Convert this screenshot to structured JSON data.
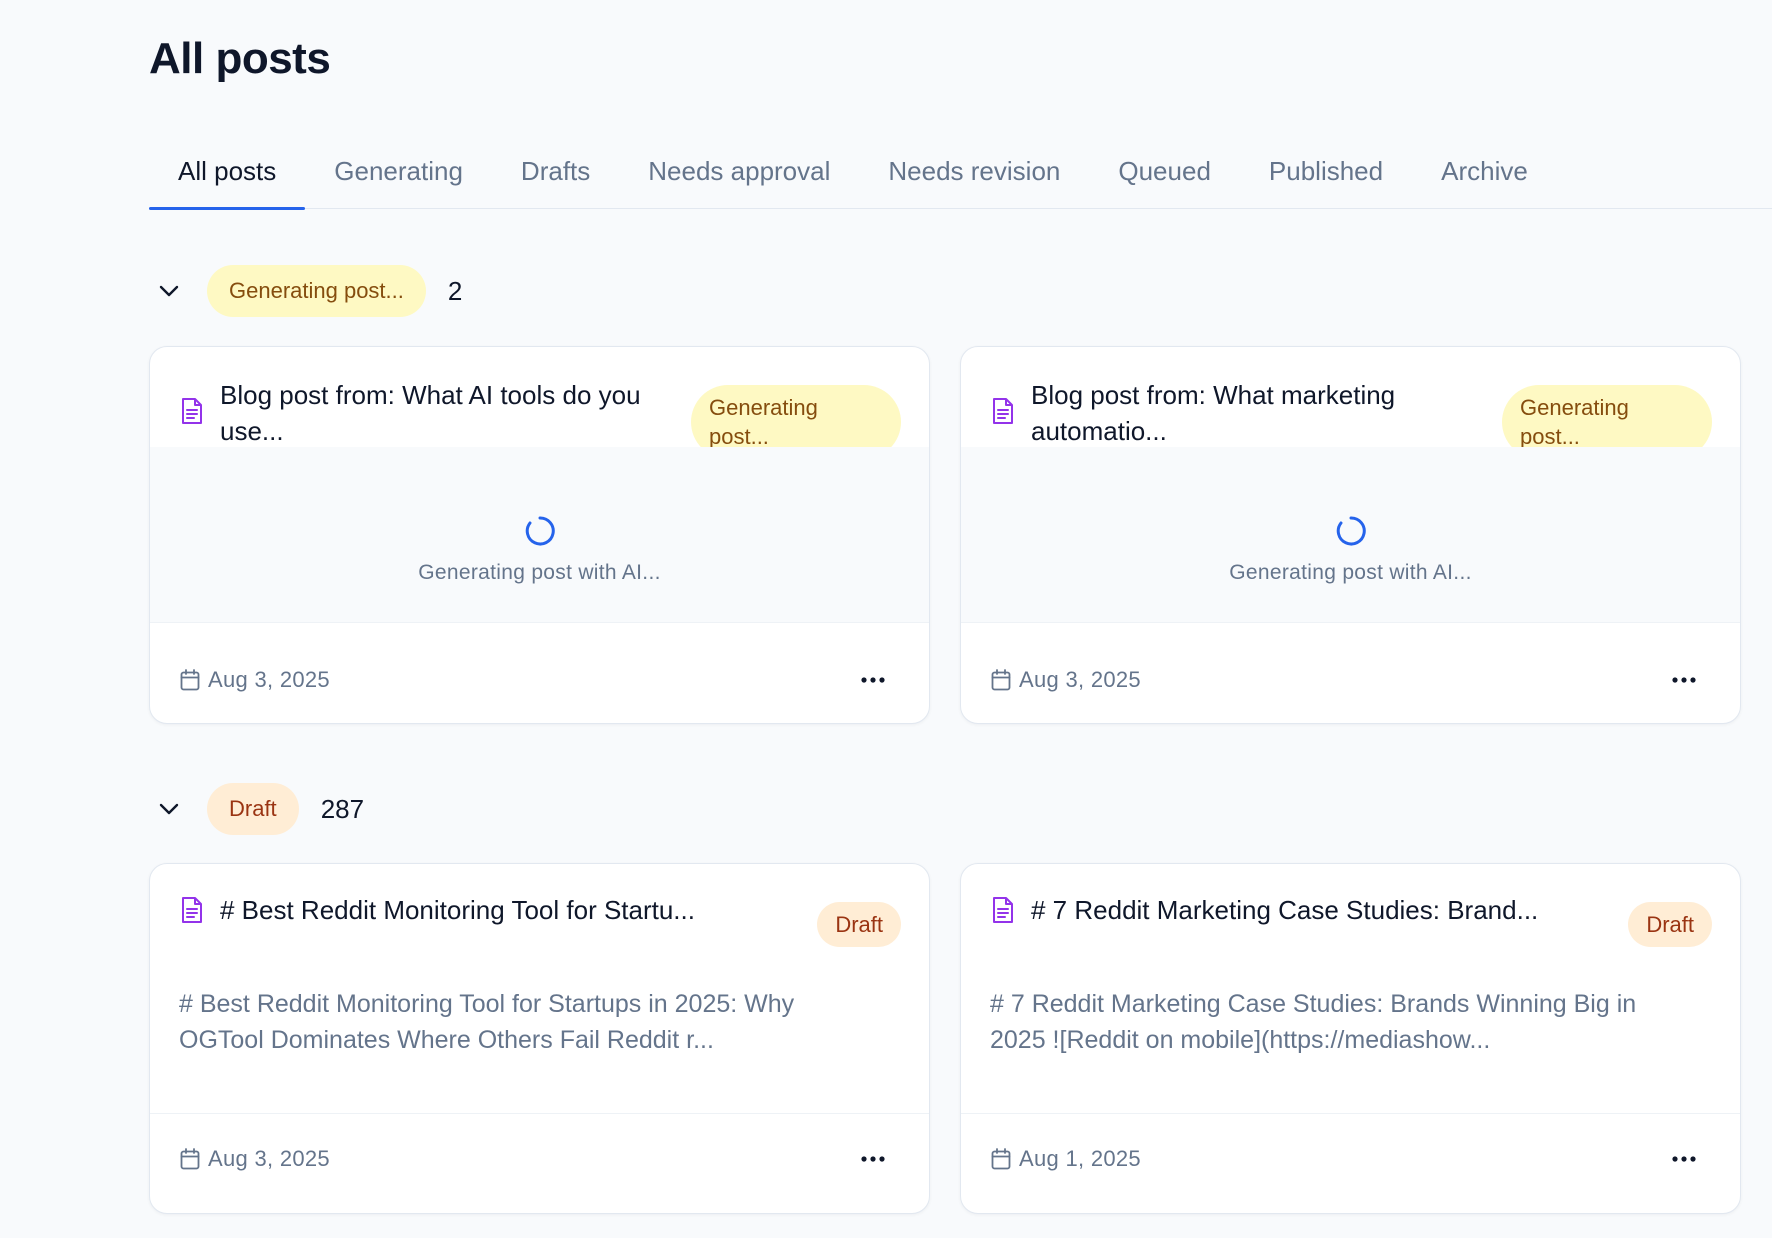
{
  "page": {
    "title": "All posts"
  },
  "tabs": [
    {
      "label": "All posts",
      "active": true
    },
    {
      "label": "Generating",
      "active": false
    },
    {
      "label": "Drafts",
      "active": false
    },
    {
      "label": "Needs approval",
      "active": false
    },
    {
      "label": "Needs revision",
      "active": false
    },
    {
      "label": "Queued",
      "active": false
    },
    {
      "label": "Published",
      "active": false
    },
    {
      "label": "Archive",
      "active": false
    }
  ],
  "groups": {
    "generating": {
      "label": "Generating post...",
      "count": "2",
      "cards": [
        {
          "title": "Blog post from: What AI tools do you use...",
          "status": "Generating post...",
          "loading_text": "Generating post with AI...",
          "date": "Aug 3, 2025"
        },
        {
          "title": "Blog post from: What marketing automatio...",
          "status": "Generating post...",
          "loading_text": "Generating post with AI...",
          "date": "Aug 3, 2025"
        }
      ]
    },
    "draft": {
      "label": "Draft",
      "count": "287",
      "cards": [
        {
          "title": "# Best Reddit Monitoring Tool for Startu...",
          "status": "Draft",
          "excerpt": "# Best Reddit Monitoring Tool for Startups in 2025: Why OGTool Dominates Where Others Fail Reddit r...",
          "date": "Aug 3, 2025"
        },
        {
          "title": "# 7 Reddit Marketing Case Studies: Brand...",
          "status": "Draft",
          "excerpt": "# 7 Reddit Marketing Case Studies: Brands Winning Big in 2025 ![Reddit on mobile](https://mediashow...",
          "date": "Aug 1, 2025"
        }
      ]
    }
  },
  "icons": {
    "document": "document-icon",
    "calendar": "calendar-icon",
    "more": "more-horizontal-icon",
    "chevron": "chevron-down-icon",
    "spinner": "spinner-icon"
  },
  "colors": {
    "accent": "#2563eb",
    "doc_icon": "#9333ea",
    "generating_bg": "#fef9c3",
    "generating_fg": "#854d0e",
    "draft_bg": "#ffedd5",
    "draft_fg": "#9a3412"
  }
}
